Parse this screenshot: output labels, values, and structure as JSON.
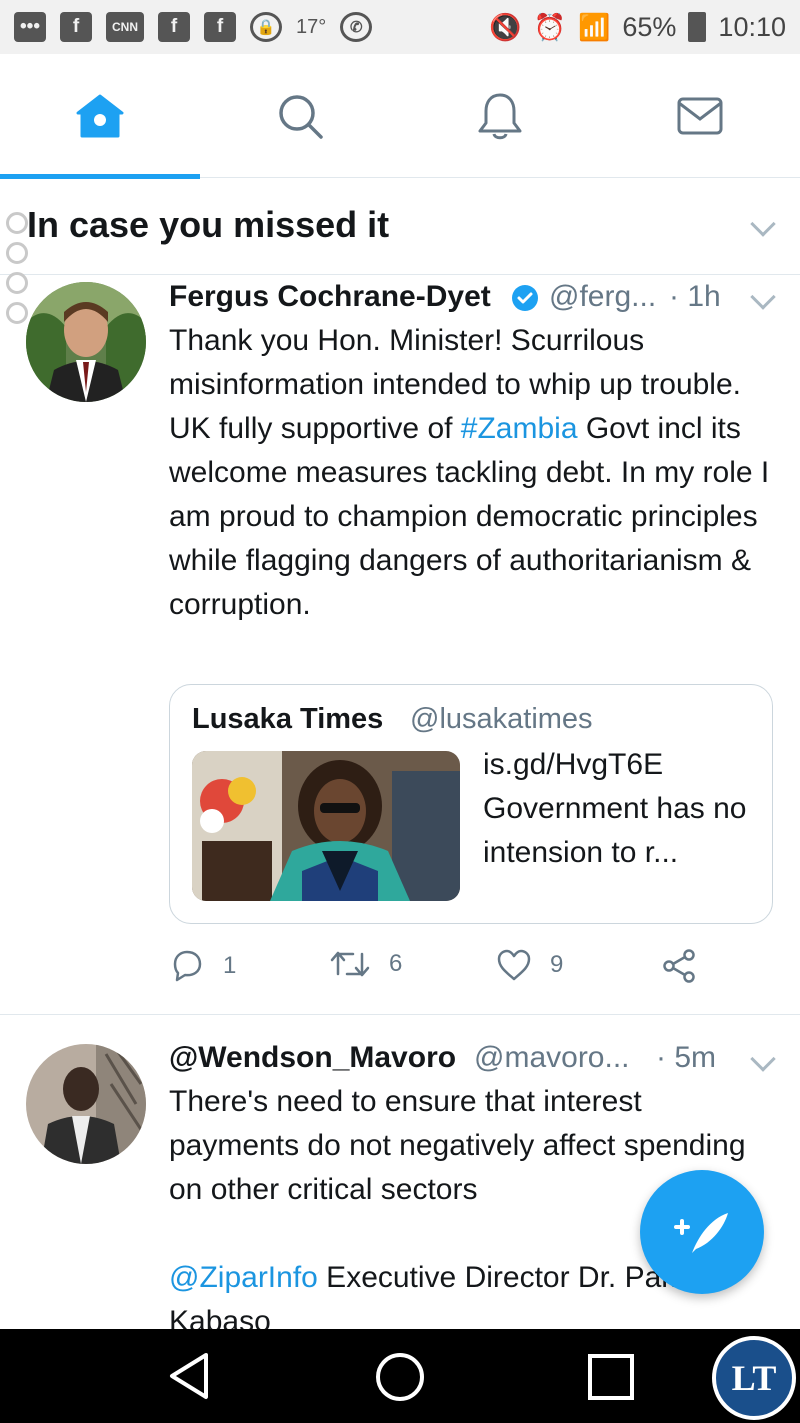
{
  "status_bar": {
    "temperature": "17°",
    "battery": "65%",
    "time": "10:10"
  },
  "tabs": [
    {
      "name": "home",
      "icon": "home-icon",
      "active": true
    },
    {
      "name": "search",
      "icon": "search-icon",
      "active": false
    },
    {
      "name": "notifications",
      "icon": "bell-icon",
      "active": false
    },
    {
      "name": "messages",
      "icon": "mail-icon",
      "active": false
    }
  ],
  "section": {
    "title": "In case you missed it"
  },
  "tweet1": {
    "name": "Fergus Cochrane-Dyet",
    "handle": "@ferg...",
    "time": "· 1h",
    "text_before": "Thank you Hon. Minister! Scurrilous misinformation intended to whip up trouble. UK fully supportive of ",
    "hashtag": "#Zambia",
    "text_after": " Govt incl its welcome measures tackling debt. In my role I am proud to champion democratic principles while flagging dangers of authoritarianism & corruption.",
    "quote": {
      "name": "Lusaka Times",
      "handle": "@lusakatimes",
      "text": "is.gd/HvgT6E Government has no intension to r..."
    },
    "replies": "1",
    "retweets": "6",
    "likes": "9"
  },
  "tweet2": {
    "name": "@Wendson_Mavoro",
    "handle": "@mavoro...",
    "time": "· 5m",
    "text": "There's need to ensure that interest payments do not negatively affect spending on other critical sectors",
    "mention": "@ZiparInfo",
    "text_after": " Executive Director Dr. Pamela Kabaso"
  },
  "watermark": {
    "text": "LT"
  },
  "colors": {
    "accent": "#1da1f2",
    "link": "#1b95e0",
    "muted": "#657786"
  }
}
